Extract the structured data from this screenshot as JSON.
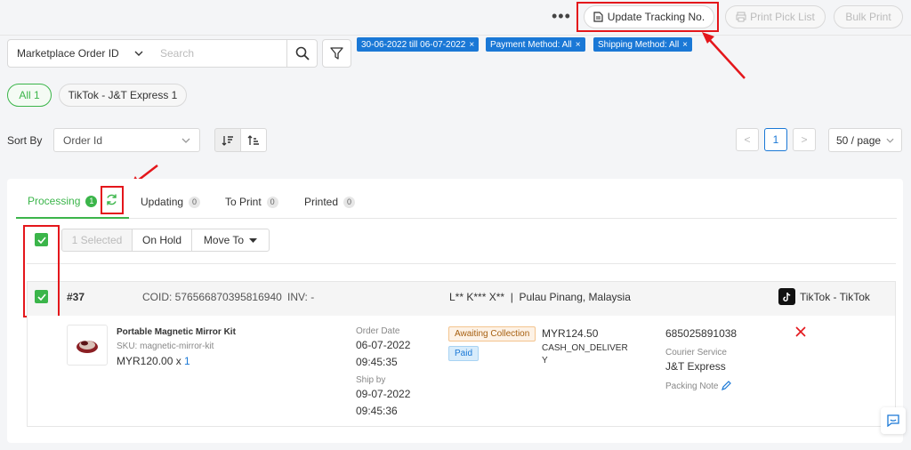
{
  "toolbar": {
    "more_label": "•••",
    "update_tracking_label": "Update Tracking No.",
    "print_pick_list_label": "Print Pick List",
    "bulk_print_label": "Bulk Print"
  },
  "search": {
    "field_select": "Marketplace Order ID",
    "placeholder": "Search"
  },
  "filter_tags": [
    "30-06-2022 till 06-07-2022",
    "Payment Method: All",
    "Shipping Method: All"
  ],
  "channel_pills": [
    {
      "label": "All 1",
      "active": true
    },
    {
      "label": "TikTok - J&T Express 1",
      "active": false
    }
  ],
  "sort": {
    "label": "Sort By",
    "value": "Order Id"
  },
  "pagination": {
    "prev": "<",
    "current": "1",
    "next": ">",
    "page_size": "50 / page"
  },
  "tabs": [
    {
      "label": "Processing",
      "count": "1",
      "active": true
    },
    {
      "label": "Updating",
      "count": "0",
      "active": false
    },
    {
      "label": "To Print",
      "count": "0",
      "active": false
    },
    {
      "label": "Printed",
      "count": "0",
      "active": false
    }
  ],
  "actions": {
    "selected": "1 Selected",
    "on_hold": "On Hold",
    "move_to": "Move To"
  },
  "order": {
    "number": "#37",
    "coid": "COID: 576566870395816940",
    "inv": "INV: -",
    "customer_location": "L** K*** X**  |  Pulau Pinang, Malaysia",
    "channel": "TikTok - TikTok",
    "product_name": "Portable Magnetic Mirror Kit",
    "sku": "SKU: magnetic-mirror-kit",
    "price": "MYR120.00 x",
    "qty": "1",
    "order_date_label": "Order Date",
    "order_date": "06-07-2022",
    "order_time": "09:45:35",
    "ship_by_label": "Ship by",
    "ship_by_date": "09-07-2022",
    "ship_by_time": "09:45:36",
    "status_badge": "Awaiting Collection",
    "payment_badge": "Paid",
    "total": "MYR124.50",
    "payment_method_line1": "CASH_ON_DELIVER",
    "payment_method_line2": "Y",
    "tracking_number": "685025891038",
    "courier_label": "Courier Service",
    "courier": "J&T Express",
    "packing_note_label": "Packing Note"
  },
  "colors": {
    "accent_green": "#3bb54a",
    "tag_blue": "#1a78d6",
    "highlight_red": "#e4161b"
  }
}
